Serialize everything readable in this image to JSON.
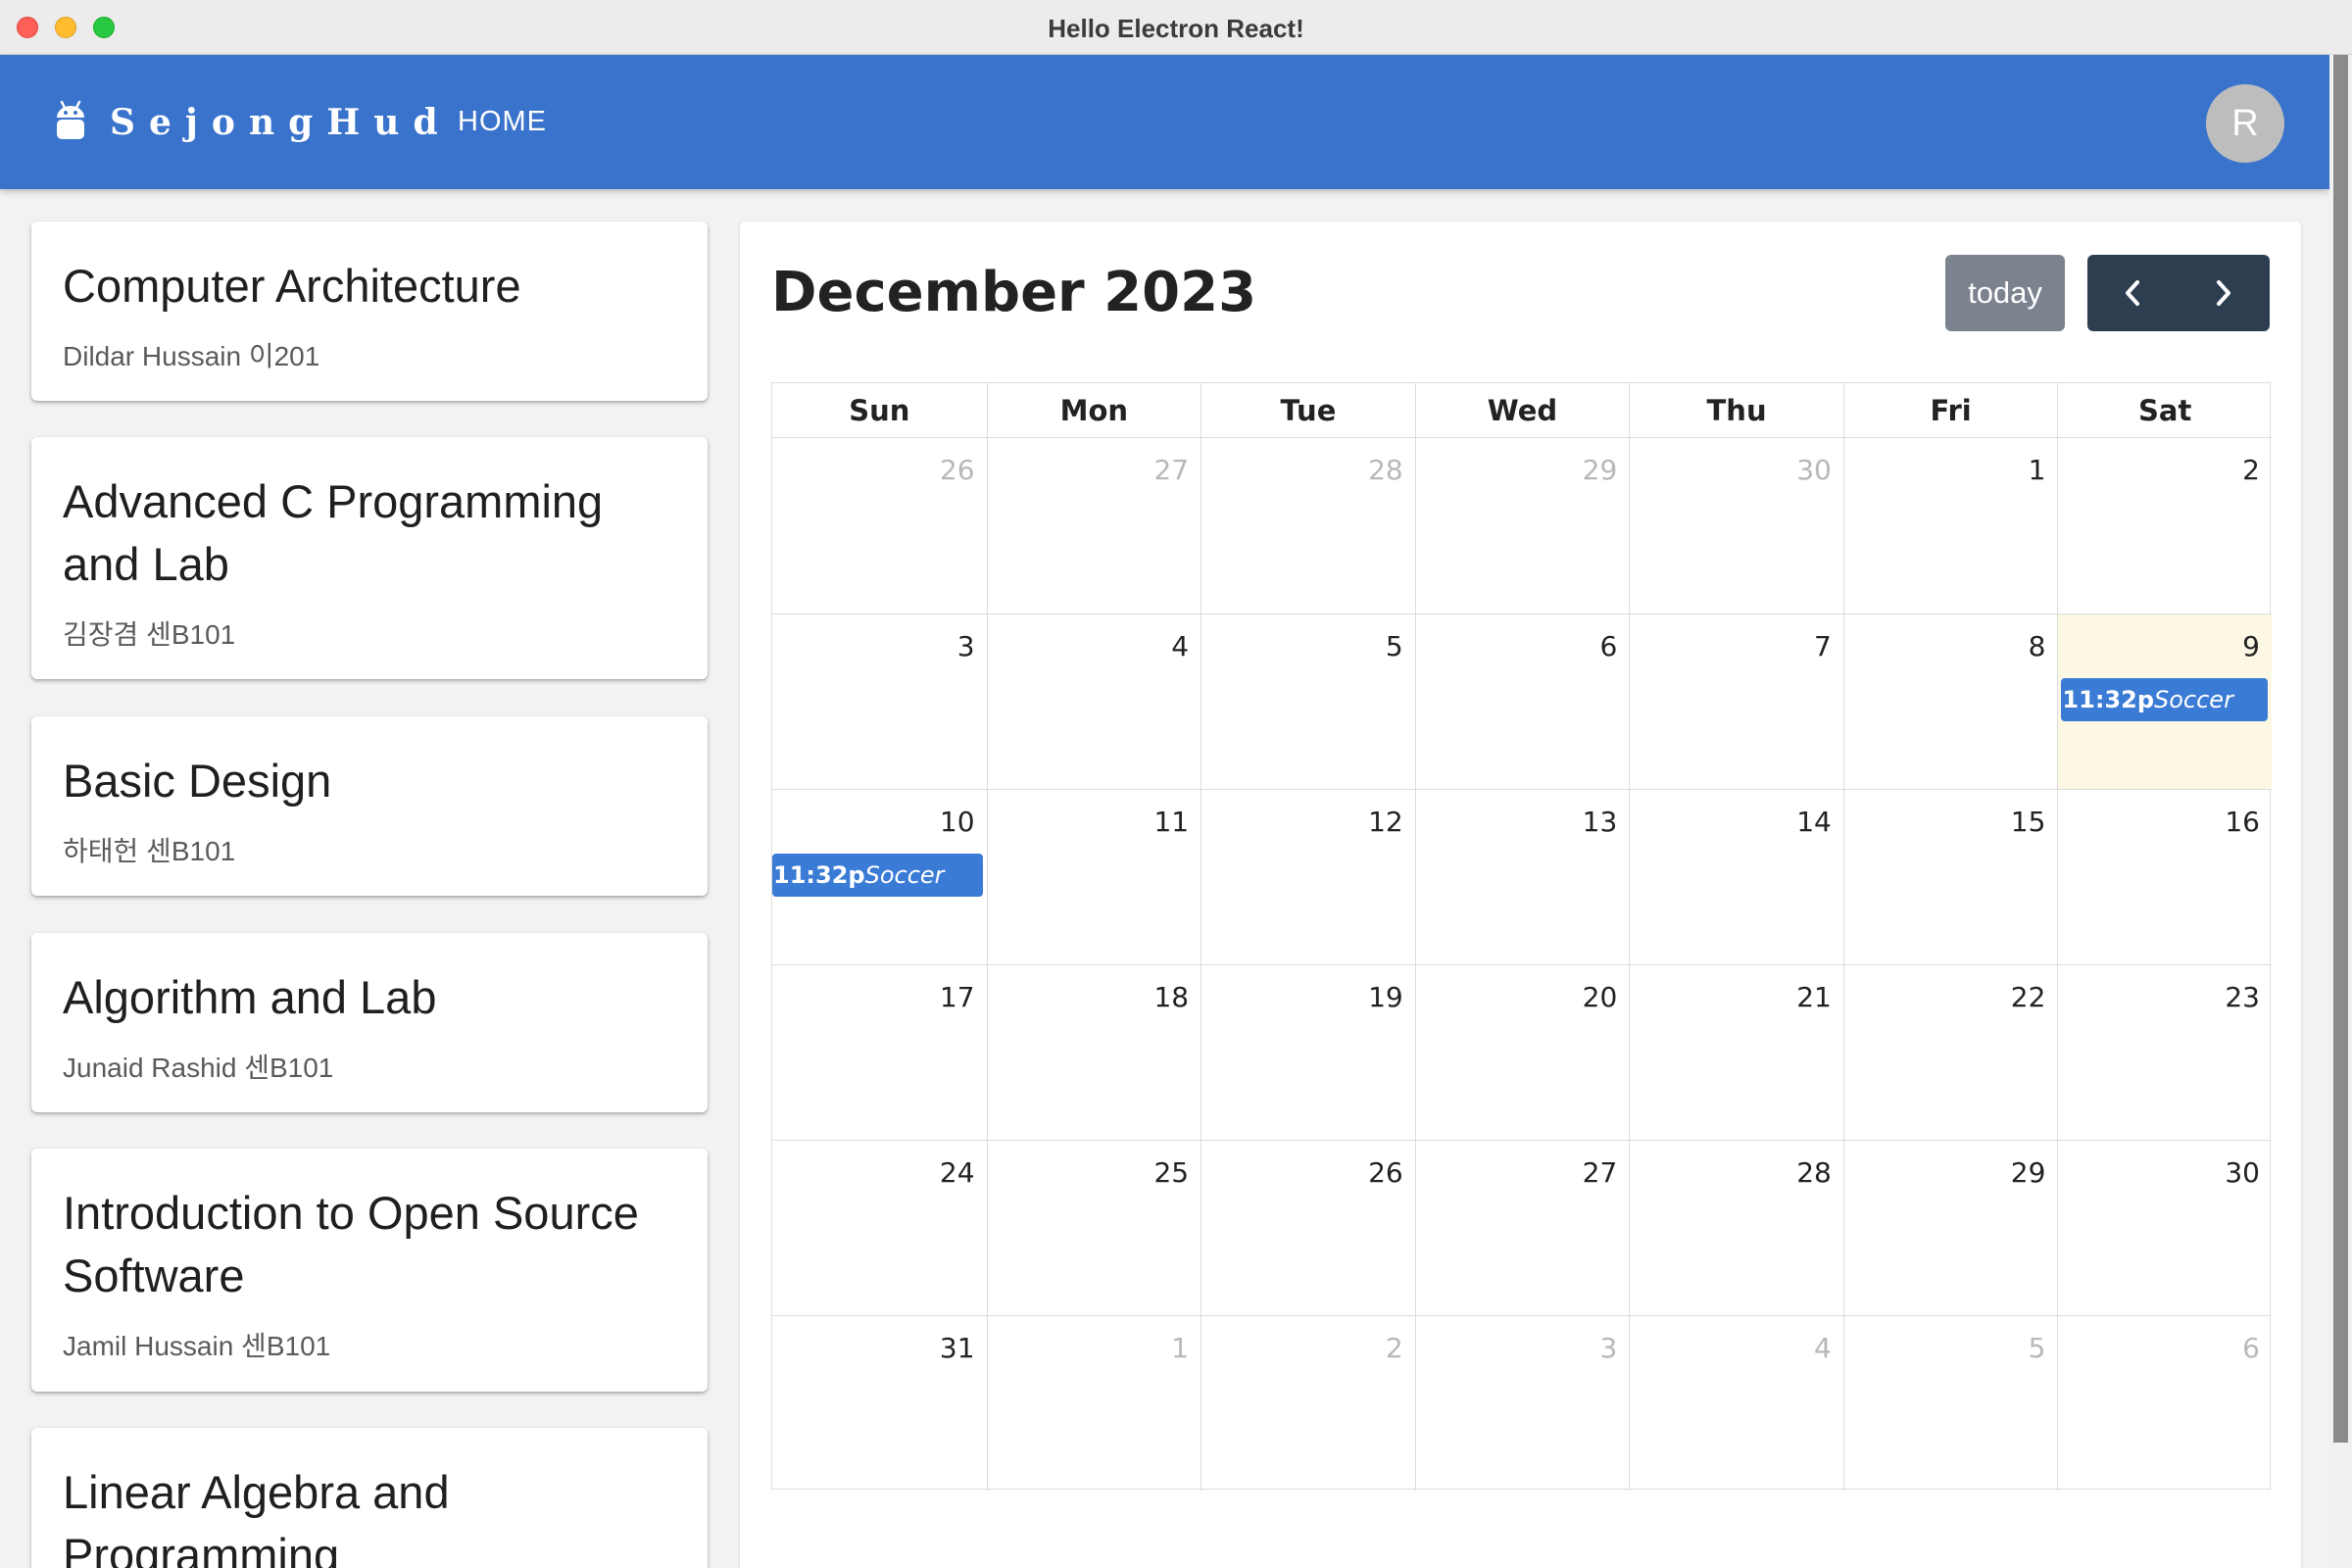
{
  "window": {
    "title": "Hello Electron React!"
  },
  "appbar": {
    "brand": "SejongHud",
    "nav_home": "HOME",
    "avatar_initial": "R",
    "logo_icon": "android-icon",
    "color": "#3a73cc"
  },
  "courses": [
    {
      "title": "Computer Architecture",
      "subtitle": "Dildar Hussain 이201"
    },
    {
      "title": "Advanced C Programming and Lab",
      "subtitle": "김장겸 센B101"
    },
    {
      "title": "Basic Design",
      "subtitle": "하태헌 센B101"
    },
    {
      "title": "Algorithm and Lab",
      "subtitle": "Junaid Rashid 센B101"
    },
    {
      "title": "Introduction to Open Source Software",
      "subtitle": "Jamil Hussain 센B101"
    },
    {
      "title": "Linear Algebra and Programming",
      "subtitle": ""
    }
  ],
  "calendar": {
    "title": "December 2023",
    "today_label": "today",
    "prev_icon": "chevron-left-icon",
    "next_icon": "chevron-right-icon",
    "days_of_week": [
      "Sun",
      "Mon",
      "Tue",
      "Wed",
      "Thu",
      "Fri",
      "Sat"
    ],
    "weeks": [
      [
        {
          "d": "26",
          "o": true
        },
        {
          "d": "27",
          "o": true
        },
        {
          "d": "28",
          "o": true
        },
        {
          "d": "29",
          "o": true
        },
        {
          "d": "30",
          "o": true
        },
        {
          "d": "1"
        },
        {
          "d": "2"
        }
      ],
      [
        {
          "d": "3"
        },
        {
          "d": "4"
        },
        {
          "d": "5"
        },
        {
          "d": "6"
        },
        {
          "d": "7"
        },
        {
          "d": "8"
        },
        {
          "d": "9",
          "today": true
        }
      ],
      [
        {
          "d": "10"
        },
        {
          "d": "11"
        },
        {
          "d": "12"
        },
        {
          "d": "13"
        },
        {
          "d": "14"
        },
        {
          "d": "15"
        },
        {
          "d": "16"
        }
      ],
      [
        {
          "d": "17"
        },
        {
          "d": "18"
        },
        {
          "d": "19"
        },
        {
          "d": "20"
        },
        {
          "d": "21"
        },
        {
          "d": "22"
        },
        {
          "d": "23"
        }
      ],
      [
        {
          "d": "24"
        },
        {
          "d": "25"
        },
        {
          "d": "26"
        },
        {
          "d": "27"
        },
        {
          "d": "28"
        },
        {
          "d": "29"
        },
        {
          "d": "30"
        }
      ],
      [
        {
          "d": "31"
        },
        {
          "d": "1",
          "o": true
        },
        {
          "d": "2",
          "o": true
        },
        {
          "d": "3",
          "o": true
        },
        {
          "d": "4",
          "o": true
        },
        {
          "d": "5",
          "o": true
        },
        {
          "d": "6",
          "o": true
        }
      ]
    ],
    "events": [
      {
        "week": 1,
        "day": 6,
        "time": "11:32p",
        "title": "Soccer"
      },
      {
        "week": 2,
        "day": 0,
        "time": "11:32p",
        "title": "Soccer"
      }
    ],
    "colors": {
      "event": "#3a7bd5",
      "today_bg": "#fcf8e3",
      "today_btn": "#7b838e",
      "nav_btn": "#2c3e50"
    }
  }
}
